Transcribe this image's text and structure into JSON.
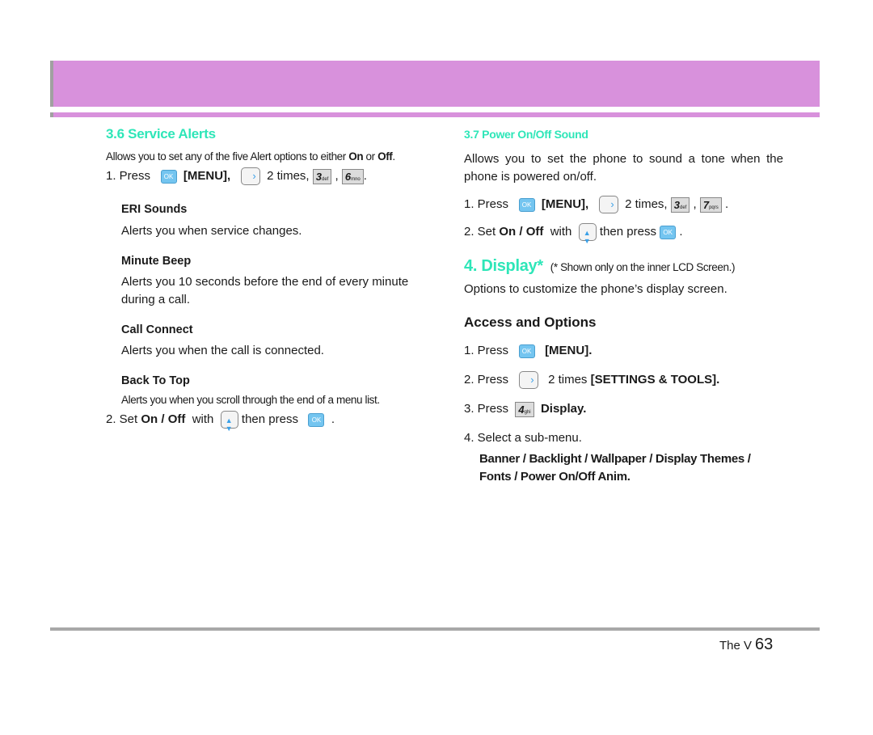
{
  "header": {
    "banner_color": "#d891dc"
  },
  "left": {
    "title": "3.6 Service Alerts",
    "intro_pre": "Allows you to set any of the five Alert options to either ",
    "intro_on": "On",
    "intro_or": " or ",
    "intro_off": "Off",
    "intro_end": ".",
    "step1": {
      "num": "1. Press",
      "menu": "[MENU],",
      "times": "2 times,",
      "key1": "3",
      "key1_sub": "def",
      "key2": "6",
      "key2_sub": "mno",
      "comma": ",",
      "end": "."
    },
    "options": [
      {
        "name": "ERI Sounds",
        "desc": "Alerts you when service changes."
      },
      {
        "name": "Minute Beep",
        "desc": "Alerts you 10 seconds before the end of every minute during a call."
      },
      {
        "name": "Call Connect",
        "desc": "Alerts you when the call is connected."
      },
      {
        "name": "Back To Top",
        "desc": "Alerts you when you scroll through the end of a menu list."
      }
    ],
    "step2": {
      "num": "2. Set",
      "onoff": "On / Off",
      "with": "with",
      "then": "then press",
      "end": "."
    }
  },
  "right": {
    "title": "3.7 Power On/Off Sound",
    "intro": "Allows you to set the phone to sound a tone when the phone is powered on/off.",
    "step1": {
      "num": "1. Press",
      "menu": "[MENU],",
      "times": "2 times,",
      "key1": "3",
      "key1_sub": "def",
      "key2": "7",
      "key2_sub": "pqrs",
      "comma": ",",
      "end": "."
    },
    "step2": {
      "num": "2. Set",
      "onoff": "On / Off",
      "with": "with",
      "then": "then press",
      "end": "."
    },
    "display_title": "4. Display*",
    "display_note": "(* Shown only on the inner LCD Screen.)",
    "display_intro": "Options to customize the phone’s display screen.",
    "access_title": "Access and Options",
    "steps": [
      {
        "num": "1. Press",
        "text": "[MENU].",
        "key": "ok"
      },
      {
        "num": "2. Press",
        "pre": "2 times ",
        "text": "[SETTINGS & TOOLS].",
        "key": "nav"
      },
      {
        "num": "3. Press",
        "text": "Display.",
        "key": "4",
        "key_sub": "ghi"
      },
      {
        "num": "4. Select a sub-menu."
      }
    ],
    "submenus_1": "Banner / Backlight / Wallpaper / Display Themes /",
    "submenus_2": "Fonts / Power On/Off Anim."
  },
  "footer": {
    "model": "The V",
    "page": "63"
  },
  "icons": {
    "ok_label": "OK",
    "right_arrow": "›",
    "up": "▲",
    "down": "▼"
  }
}
